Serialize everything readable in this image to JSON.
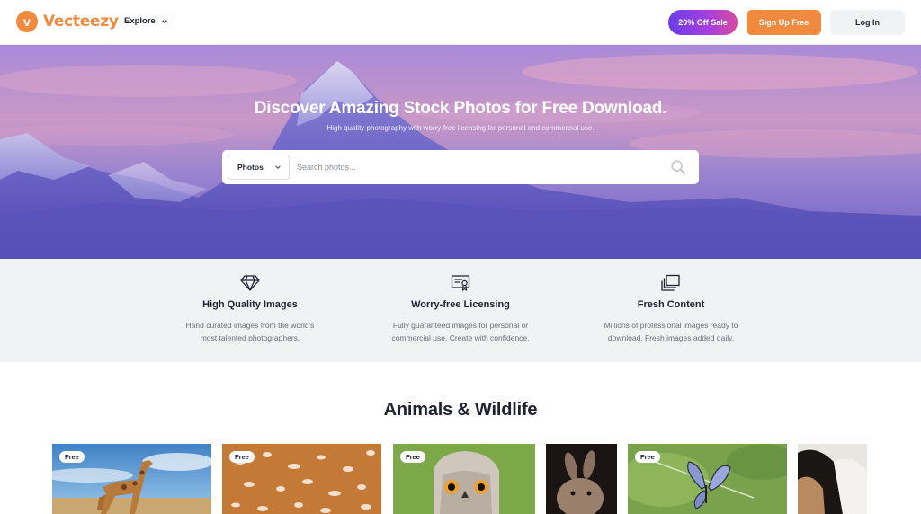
{
  "header": {
    "logo_text": "Vecteezy",
    "explore_label": "Explore",
    "sale_label": "20% Off Sale",
    "signup_label": "Sign Up Free",
    "login_label": "Log In"
  },
  "hero": {
    "title": "Discover Amazing Stock Photos for Free Download.",
    "subtitle": "High quality photography with worry-free licensing for personal and commercial use.",
    "search": {
      "type_selected": "Photos",
      "placeholder": "Search photos..."
    }
  },
  "features": [
    {
      "icon": "diamond-icon",
      "title": "High Quality Images",
      "line1": "Hand curated images from the world's",
      "line2": "most talented photographers."
    },
    {
      "icon": "certificate-icon",
      "title": "Worry-free Licensing",
      "line1": "Fully guaranteed images for personal or",
      "line2": "commercial use. Create with confidence."
    },
    {
      "icon": "stacked-images-icon",
      "title": "Fresh Content",
      "line1": "Millions of professional images ready to",
      "line2": "download. Fresh images added daily."
    }
  ],
  "section": {
    "title": "Animals & Wildlife",
    "thumbs": [
      {
        "subject": "giraffe",
        "badge": "Free"
      },
      {
        "subject": "deer-fur",
        "badge": "Free"
      },
      {
        "subject": "owl",
        "badge": "Free"
      },
      {
        "subject": "rabbit",
        "badge": ""
      },
      {
        "subject": "butterfly",
        "badge": "Free"
      },
      {
        "subject": "dog",
        "badge": ""
      }
    ]
  },
  "colors": {
    "brand_orange": "#f08a3e",
    "sale_gradient_start": "#6a3ee8",
    "sale_gradient_end": "#d84aa0",
    "features_bg": "#f1f2f4",
    "text_dark": "#1f2230"
  }
}
